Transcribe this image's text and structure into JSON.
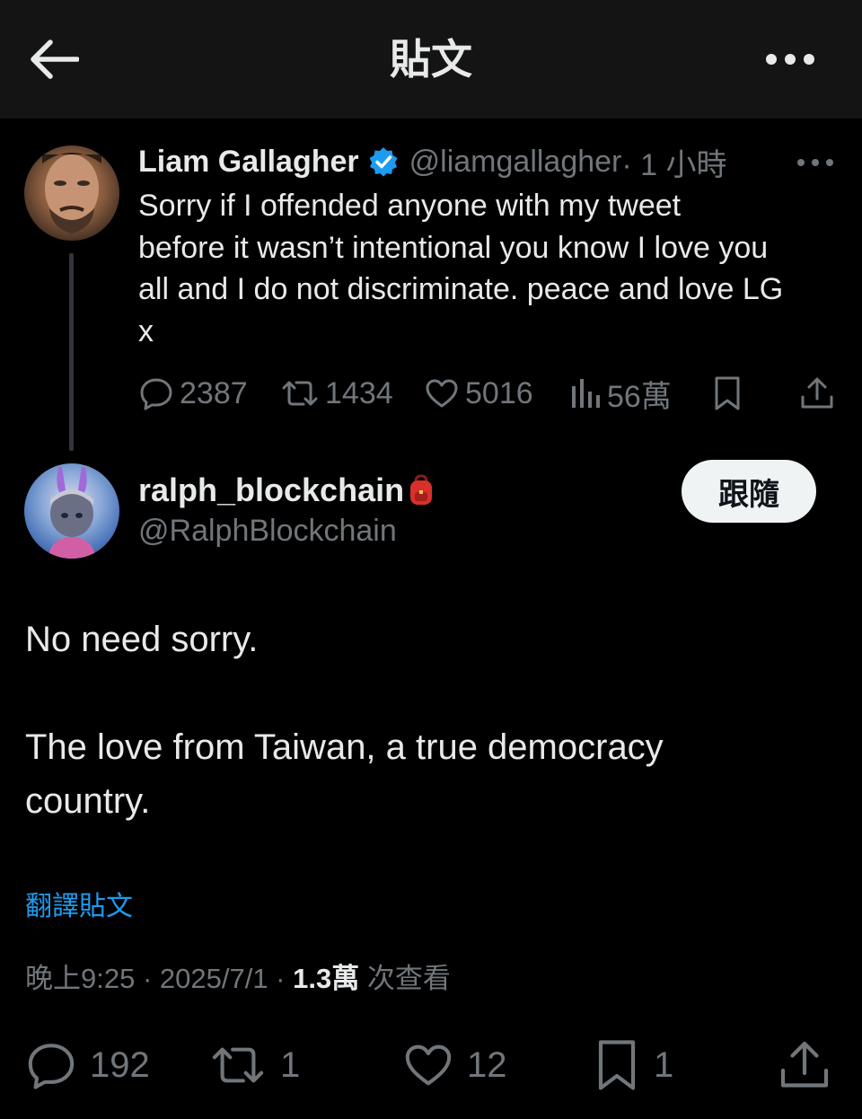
{
  "header": {
    "title": "貼文",
    "back_icon": "arrow-left-icon",
    "more_icon": "ellipsis-icon"
  },
  "parent_tweet": {
    "name": "Liam Gallagher",
    "handle": "@liamgallagher",
    "time": " · 1 小時",
    "verified_color": "#1d9bf0",
    "text_lines": [
      "Sorry if I offended anyone with my tweet",
      "before it wasn’t intentional you know I love you",
      "all and I do not discriminate. peace and love LG",
      "x"
    ],
    "stats": {
      "replies": "2387",
      "reposts": "1434",
      "likes": "5016",
      "views": "56萬"
    }
  },
  "reply": {
    "name": "ralph_blockchain",
    "handle": "@RalphBlockchain",
    "follow_label": "跟隨",
    "body_lines": [
      "No need sorry.",
      "The love from Taiwan, a true democracy",
      "country."
    ],
    "translate_label": "翻譯貼文",
    "meta": {
      "time": "晚上9:25 · 2025/7/1 · ",
      "views": "1.3萬",
      "views_label": " 次查看"
    },
    "stats": {
      "replies": "192",
      "reposts": "1",
      "likes": "12",
      "bookmarks": "1"
    }
  },
  "colors": {
    "accent": "#1d9bf0",
    "muted": "#71767b",
    "text": "#e7e9ea",
    "background": "#000000"
  }
}
